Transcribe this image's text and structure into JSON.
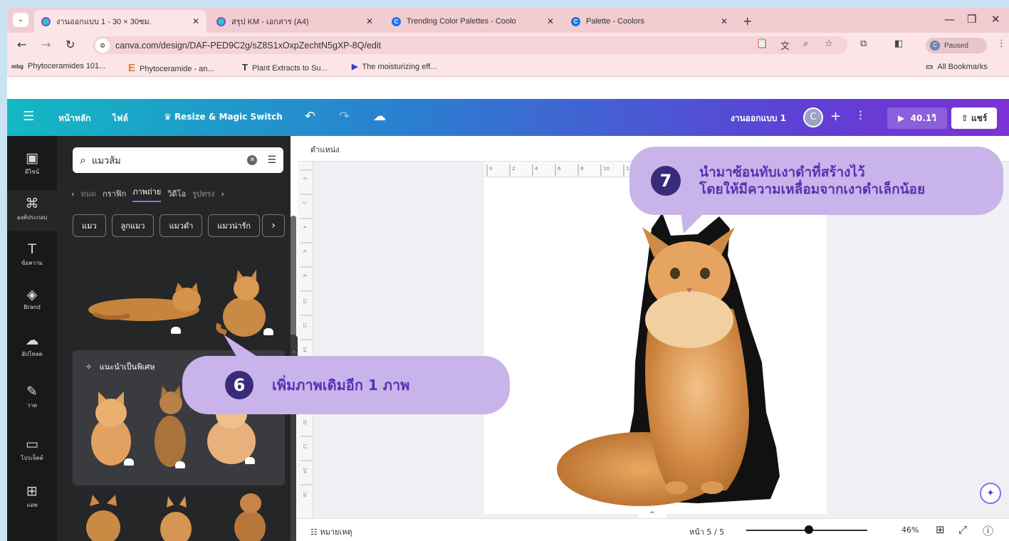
{
  "browser": {
    "tabs": [
      {
        "title": "งานออกแบบ 1 - 30 × 30ซม.",
        "icon": "canva-icon",
        "active": true
      },
      {
        "title": "สรุป KM - เอกสาร (A4)",
        "icon": "canva-icon",
        "active": false
      },
      {
        "title": "Trending Color Palettes - Coolo",
        "icon": "coolors-icon",
        "active": false
      },
      {
        "title": "Palette - Coolors",
        "icon": "coolors-icon",
        "active": false
      }
    ],
    "url": "canva.com/design/DAF-PED9C2g/sZ8S1xOxpZechtN5gXP-8Q/edit",
    "paused_label": "Paused",
    "bookmarks": [
      {
        "icon": "mbg",
        "label": "Phytoceramides 101..."
      },
      {
        "icon": "E",
        "label": "Phytoceramide - an..."
      },
      {
        "icon": "T",
        "label": "Plant Extracts to Su..."
      },
      {
        "icon": "▶",
        "label": "The moisturizing eff..."
      }
    ],
    "all_bookmarks": "All Bookmarks"
  },
  "canva": {
    "home": "หน้าหลัก",
    "file": "ไฟล์",
    "resize": "Resize & Magic Switch",
    "design_name": "งานออกแบบ 1",
    "avatar": "C",
    "present_time": "40.1วิ",
    "share": "แชร์"
  },
  "rail": [
    {
      "icon": "▣",
      "label": "ดีไซน์"
    },
    {
      "icon": "⌘",
      "label": "องค์ประกอบ",
      "selected": true
    },
    {
      "icon": "T",
      "label": "ข้อความ"
    },
    {
      "icon": "◈",
      "label": "Brand"
    },
    {
      "icon": "☁",
      "label": "อัปโหลด"
    },
    {
      "icon": "✎",
      "label": "วาด"
    },
    {
      "icon": "▭",
      "label": "โปรเจ็คต์"
    },
    {
      "icon": "⊞",
      "label": "แอพ"
    }
  ],
  "panel": {
    "search_value": "แมวส้ม",
    "categories": [
      "ทมด",
      "กราฟิก",
      "ภาพถ่าย",
      "วิดีโอ",
      "รูปทรง"
    ],
    "active_category": "ภาพถ่าย",
    "chips": [
      "แมว",
      "ลูกแมว",
      "แมวดำ",
      "แมวน่ารัก"
    ],
    "recommended": "แนะนำเป็นพิเศษ"
  },
  "workspace": {
    "position_label": "ตำแหน่ง",
    "ruler_ticks": [
      "0",
      "2",
      "4",
      "6",
      "8",
      "10",
      "12"
    ],
    "vruler_ticks": [
      "0",
      "2",
      "4",
      "6",
      "8",
      "10",
      "12",
      "14",
      "16",
      "18",
      "20",
      "22",
      "24",
      "26"
    ],
    "notes": "หมายเหตุ",
    "page_indicator": "หน้า 5 / 5",
    "zoom": "46%"
  },
  "callouts": {
    "step6": {
      "number": "6",
      "text": "เพิ่มภาพเดิมอีก 1 ภาพ"
    },
    "step7": {
      "number": "7",
      "line1": "นำมาซ้อนทับเงาดำที่สร้างไว้",
      "line2": "โดยให้มีความเหลื่อมจากเงาดำเล็กน้อย"
    }
  },
  "colors": {
    "callout_bg": "#c8b4ea",
    "callout_text": "#5b2fb3",
    "badge": "#3a2a7a",
    "canva_gradient_start": "#13b8c4",
    "canva_gradient_end": "#7c33d4"
  }
}
